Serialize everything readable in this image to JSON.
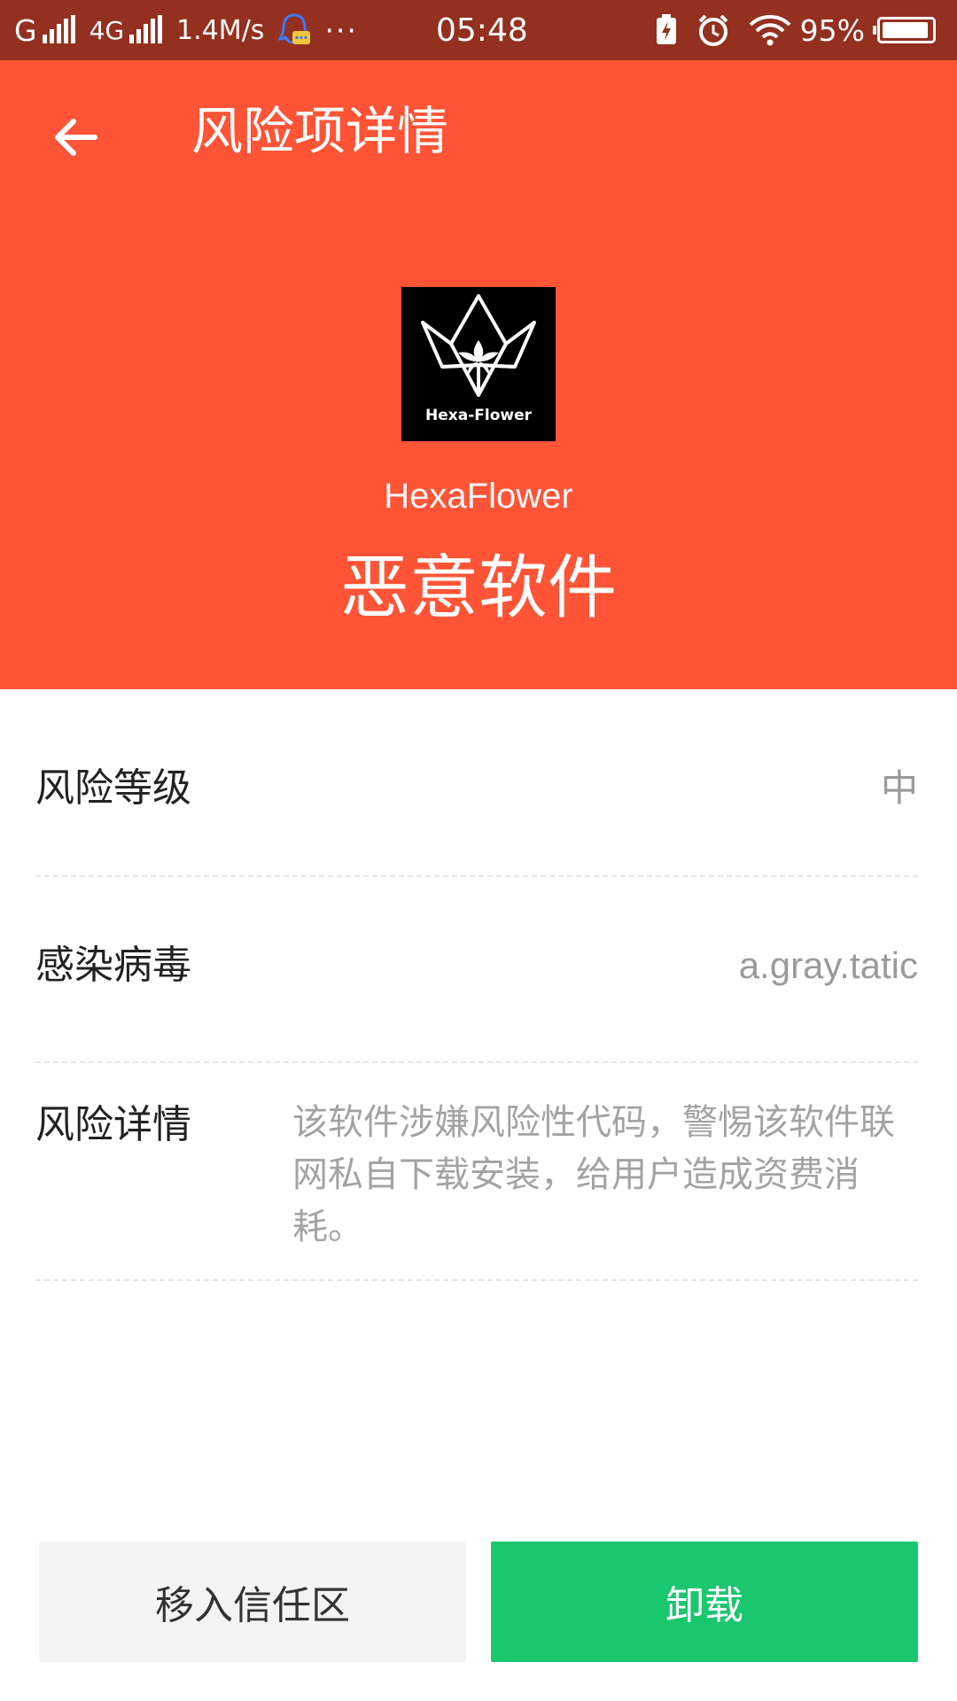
{
  "status_bar": {
    "carrier1": "G",
    "carrier2": "4G",
    "speed": "1.4M/s",
    "more": "···",
    "time": "05:48",
    "battery_percent": "95%",
    "battery_level": 0.95
  },
  "header": {
    "title": "风险项详情",
    "app_icon_text": "Hexa-Flower",
    "app_name": "HexaFlower",
    "risk_type": "恶意软件"
  },
  "details": {
    "risk_level_label": "风险等级",
    "risk_level_value": "中",
    "virus_label": "感染病毒",
    "virus_value": "a.gray.tatic",
    "detail_label": "风险详情",
    "detail_text": "该软件涉嫌风险性代码，警惕该软件联网私自下载安装，给用户造成资费消耗。"
  },
  "buttons": {
    "trust": "移入信任区",
    "uninstall": "卸载"
  },
  "colors": {
    "header_bg": "#ff5436",
    "status_bg": "#93301f",
    "uninstall_bg": "#1ac66e"
  }
}
